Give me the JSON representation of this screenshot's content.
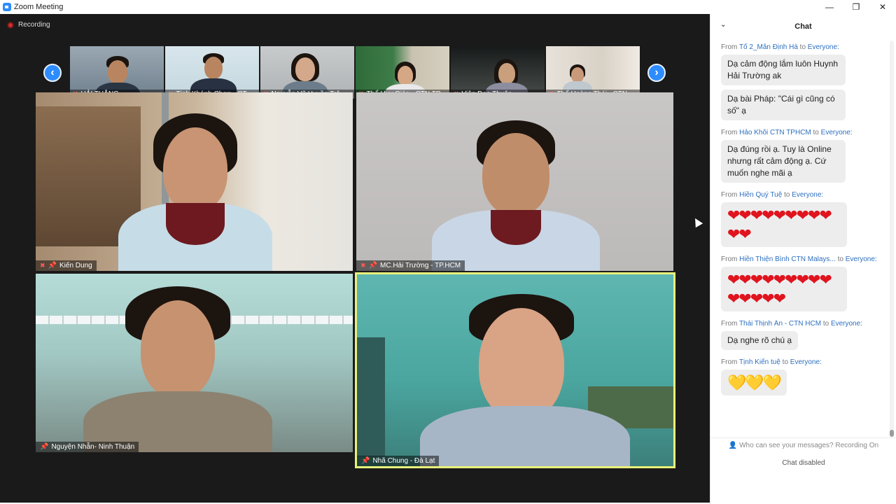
{
  "window": {
    "title": "Zoom Meeting",
    "minimize_icon": "minimize-icon",
    "restore_icon": "restore-icon",
    "close_icon": "close-icon"
  },
  "meeting": {
    "recording_label": "Recording",
    "prev_icon": "chevron-left-icon",
    "next_icon": "chevron-right-icon",
    "thumbnails": [
      {
        "name": "HẢI THẮNG"
      },
      {
        "name": "Tịnh Khánh Chơn - CT..."
      },
      {
        "name": "Nguyễn Vũ Huyền Trâ..."
      },
      {
        "name": "Thể Huy Giác - CTN TP..."
      },
      {
        "name": "Viên Đạo Thuận"
      },
      {
        "name": "Thể Hoàng Thái_ CTN ..."
      }
    ],
    "tiles": [
      {
        "name": "Kiến Dung"
      },
      {
        "name": "MC.Hải Trường - TP.HCM"
      },
      {
        "name": "Nguyện Nhẫn- Ninh Thuận"
      },
      {
        "name": "Nhã Chung - Đà Lạt"
      }
    ]
  },
  "chat": {
    "title": "Chat",
    "collapse_icon": "chevron-down-icon",
    "from_prefix": "From",
    "to_word": "to",
    "messages": [
      {
        "from": "Tố 2_Mẫn Định Hà",
        "to": "Everyone:",
        "texts": [
          "Dạ cảm động lắm luôn Huynh Hải Trường ak",
          "Dạ bài Pháp: \"Cái gì cũng có số\" ạ"
        ]
      },
      {
        "from": "Hảo Khôi CTN TPHCM",
        "to": "Everyone:",
        "texts": [
          "Dạ đúng rồi ạ. Tuy là Online nhưng rất cảm động ạ. Cứ muốn nghe mãi ạ"
        ]
      },
      {
        "from": "Hiền Quý Tuệ",
        "to": "Everyone:",
        "emoji": "❤❤❤❤❤❤❤❤❤❤❤"
      },
      {
        "from": "Hiền Thiện Bình  CTN Malays...",
        "to": "Everyone:",
        "emoji": "❤❤❤❤❤❤❤❤❤❤❤❤❤❤"
      },
      {
        "from": "Thái Thịnh Ân - CTN HCM",
        "to": "Everyone:",
        "texts": [
          "Dạ nghe rõ chú ạ"
        ]
      },
      {
        "from": "Tịnh Kiến tuệ",
        "to": "Everyone:",
        "emoji_yellow": "💛💛💛"
      }
    ],
    "privacy_text": "Who can see your messages? Recording On",
    "disabled_text": "Chat disabled"
  }
}
